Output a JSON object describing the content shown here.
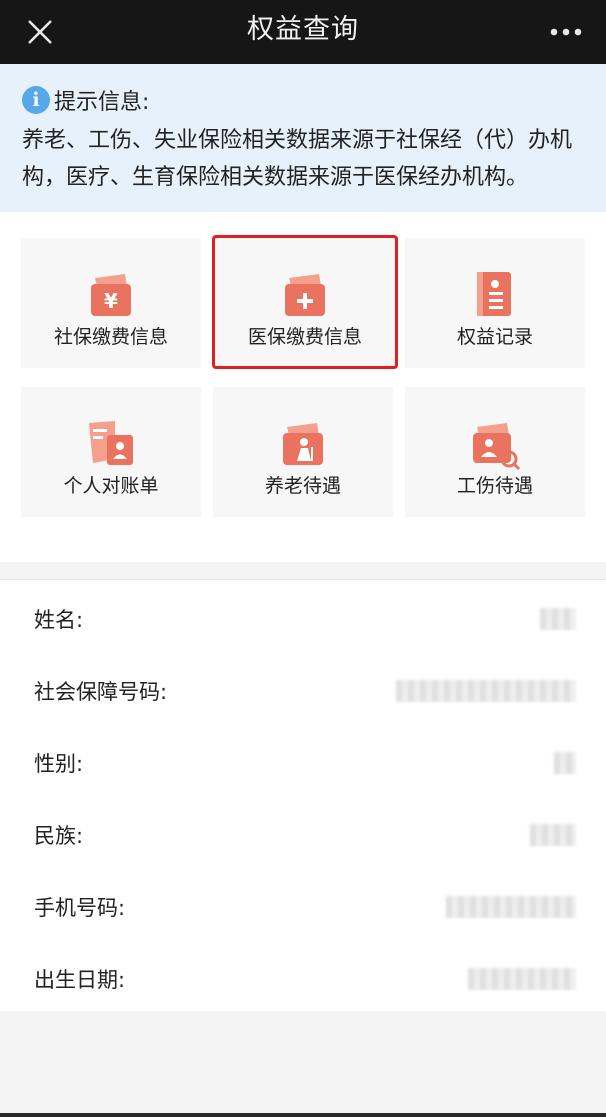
{
  "header": {
    "title": "权益查询",
    "close_icon": "close-icon",
    "more_icon": "more-dots-icon"
  },
  "notice": {
    "icon": "info-icon",
    "icon_glyph": "i",
    "heading": "提示信息:",
    "text": "养老、工伤、失业保险相关数据来源于社保经（代）办机构，医疗、生育保险相关数据来源于医保经办机构。"
  },
  "tiles": [
    {
      "label": "社保缴费信息",
      "icon": "yuan-wallet-icon"
    },
    {
      "label": "医保缴费信息",
      "icon": "medical-wallet-icon"
    },
    {
      "label": "权益记录",
      "icon": "record-book-icon"
    },
    {
      "label": "个人对账单",
      "icon": "statement-icon"
    },
    {
      "label": "养老待遇",
      "icon": "pension-elder-icon"
    },
    {
      "label": "工伤待遇",
      "icon": "injury-search-icon"
    }
  ],
  "profile": [
    {
      "label": "姓名:",
      "value": ""
    },
    {
      "label": "社会保障号码:",
      "value": ""
    },
    {
      "label": "性别:",
      "value": ""
    },
    {
      "label": "民族:",
      "value": ""
    },
    {
      "label": "手机号码:",
      "value": ""
    },
    {
      "label": "出生日期:",
      "value": ""
    }
  ],
  "colors": {
    "icon_primary": "#e9735e",
    "icon_secondary": "#f5a08c",
    "highlight": "#e02020",
    "notice_bg": "#e7f1fb",
    "info": "#56a8e8"
  }
}
